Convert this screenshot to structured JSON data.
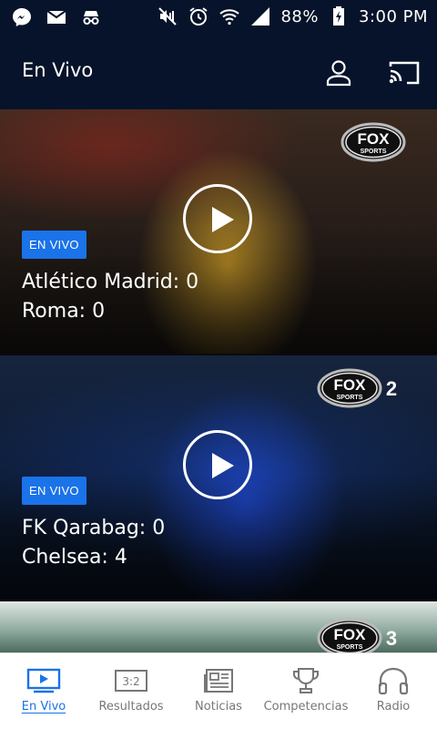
{
  "status_bar": {
    "battery": "88%",
    "time": "3:00 PM",
    "left_icons": [
      "messenger-icon",
      "mail-icon",
      "incognito-icon"
    ],
    "right_icons": [
      "mute-icon",
      "alarm-icon",
      "wifi-icon",
      "signal-icon",
      "battery-icon"
    ]
  },
  "app_bar": {
    "title": "En Vivo",
    "icons": [
      "user-icon",
      "cast-icon"
    ]
  },
  "cards": [
    {
      "badge": "EN VIVO",
      "team1": "Atlético Madrid: 0",
      "team2": "Roma: 0",
      "channel_logo": "FOX SPORTS"
    },
    {
      "badge": "EN VIVO",
      "team1": "FK Qarabag: 0",
      "team2": "Chelsea: 4",
      "channel_logo": "FOX SPORTS 2"
    },
    {
      "channel_logo": "FOX SPORTS 3"
    }
  ],
  "bottom_nav": {
    "items": [
      {
        "label": "En Vivo",
        "icon": "tv-icon",
        "active": true
      },
      {
        "label": "Resultados",
        "icon": "scoreboard-icon",
        "icon_text": "3:2"
      },
      {
        "label": "Noticias",
        "icon": "newspaper-icon"
      },
      {
        "label": "Competencias",
        "icon": "trophy-icon"
      },
      {
        "label": "Radio",
        "icon": "headphones-icon"
      }
    ]
  },
  "colors": {
    "header_bg": "#06132a",
    "accent": "#1a73e8",
    "nav_inactive": "#777777"
  }
}
